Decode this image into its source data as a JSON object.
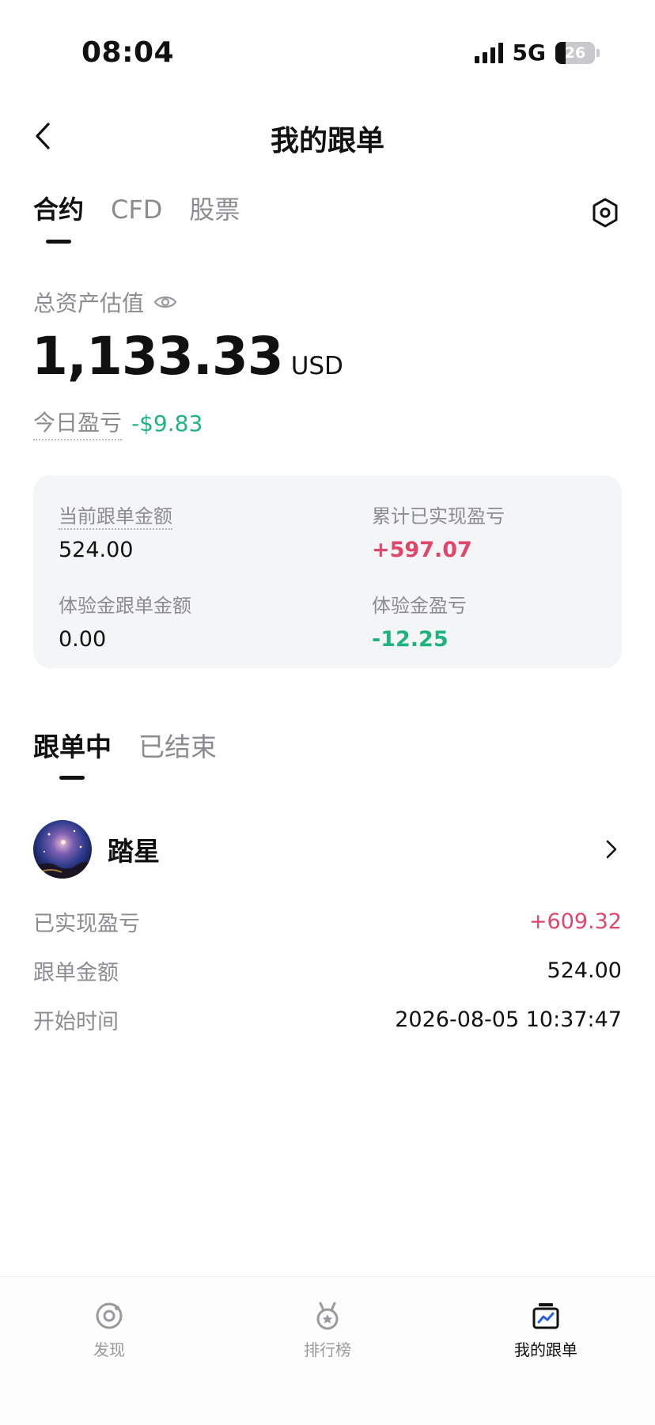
{
  "status_bar": {
    "time": "08:04",
    "network": "5G",
    "battery_level": "26",
    "battery_fraction": 0.26
  },
  "header": {
    "title": "我的跟单"
  },
  "top_tabs": [
    {
      "label": "合约",
      "active": true
    },
    {
      "label": "CFD",
      "active": false
    },
    {
      "label": "股票",
      "active": false
    }
  ],
  "assets": {
    "label": "总资产估值",
    "value": "1,133.33",
    "unit": "USD",
    "today_label": "今日盈亏",
    "today_value": "-$9.83"
  },
  "summary": {
    "current_amount_label": "当前跟单金额",
    "current_amount_value": "524.00",
    "realized_pnl_label": "累计已实现盈亏",
    "realized_pnl_value": "+597.07",
    "trial_amount_label": "体验金跟单金额",
    "trial_amount_value": "0.00",
    "trial_pnl_label": "体验金盈亏",
    "trial_pnl_value": "-12.25"
  },
  "follow_tabs": [
    {
      "label": "跟单中",
      "active": true
    },
    {
      "label": "已结束",
      "active": false
    }
  ],
  "trader": {
    "name": "踏星",
    "realized_pnl_label": "已实现盈亏",
    "realized_pnl_value": "+609.32",
    "amount_label": "跟单金额",
    "amount_value": "524.00",
    "start_time_label": "开始时间",
    "start_time_value": "2026-08-05 10:37:47"
  },
  "bottom_nav": [
    {
      "label": "发现",
      "icon": "discover-icon",
      "active": false
    },
    {
      "label": "排行榜",
      "icon": "ranking-medal-icon",
      "active": false
    },
    {
      "label": "我的跟单",
      "icon": "my-copy-trade-icon",
      "active": true
    }
  ],
  "colors": {
    "positive": "#e0466a",
    "negative": "#1fb47f",
    "muted": "#8c8c90",
    "card_bg": "#f4f5f6",
    "nav_active": "#2b5fd9"
  }
}
